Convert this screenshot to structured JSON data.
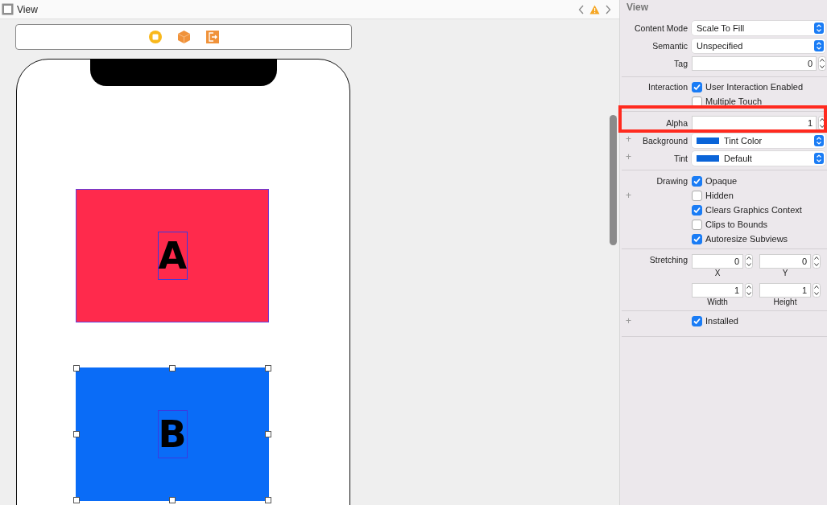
{
  "editor": {
    "title": "View"
  },
  "canvas": {
    "views": [
      {
        "label": "A",
        "color": "#ff2a4c",
        "selected": false
      },
      {
        "label": "B",
        "color": "#0a6cf7",
        "selected": true
      }
    ]
  },
  "inspector": {
    "title": "View",
    "sections": [
      {
        "rows": [
          {
            "kind": "popup",
            "label": "Content Mode",
            "value": "Scale To Fill"
          },
          {
            "kind": "popup",
            "label": "Semantic",
            "value": "Unspecified"
          },
          {
            "kind": "stepper",
            "label": "Tag",
            "value": "0"
          }
        ]
      },
      {
        "rows": [
          {
            "kind": "checkbox",
            "label": "Interaction",
            "text": "User Interaction Enabled",
            "checked": true
          },
          {
            "kind": "checkbox",
            "text": "Multiple Touch",
            "checked": false
          }
        ]
      },
      {
        "rows": [
          {
            "kind": "stepper",
            "label": "Alpha",
            "value": "1"
          },
          {
            "kind": "color",
            "label": "Background",
            "value": "Tint Color",
            "plus": "+"
          },
          {
            "kind": "color",
            "label": "Tint",
            "value": "Default",
            "plus": "+"
          }
        ]
      },
      {
        "rows": [
          {
            "kind": "checkbox",
            "label": "Drawing",
            "text": "Opaque",
            "checked": true
          },
          {
            "kind": "checkbox",
            "text": "Hidden",
            "checked": false,
            "plus": "+"
          },
          {
            "kind": "checkbox",
            "text": "Clears Graphics Context",
            "checked": true
          },
          {
            "kind": "checkbox",
            "text": "Clips to Bounds",
            "checked": false
          },
          {
            "kind": "checkbox",
            "text": "Autoresize Subviews",
            "checked": true
          }
        ]
      },
      {
        "rows": [
          {
            "kind": "pair",
            "label": "Stretching",
            "fields": [
              {
                "value": "0",
                "caption": "X"
              },
              {
                "value": "0",
                "caption": "Y"
              }
            ]
          },
          {
            "kind": "pair",
            "fields": [
              {
                "value": "1",
                "caption": "Width"
              },
              {
                "value": "1",
                "caption": "Height"
              }
            ]
          }
        ]
      },
      {
        "rows": [
          {
            "kind": "checkbox",
            "text": "Installed",
            "checked": true,
            "plus": "+"
          }
        ]
      }
    ]
  }
}
